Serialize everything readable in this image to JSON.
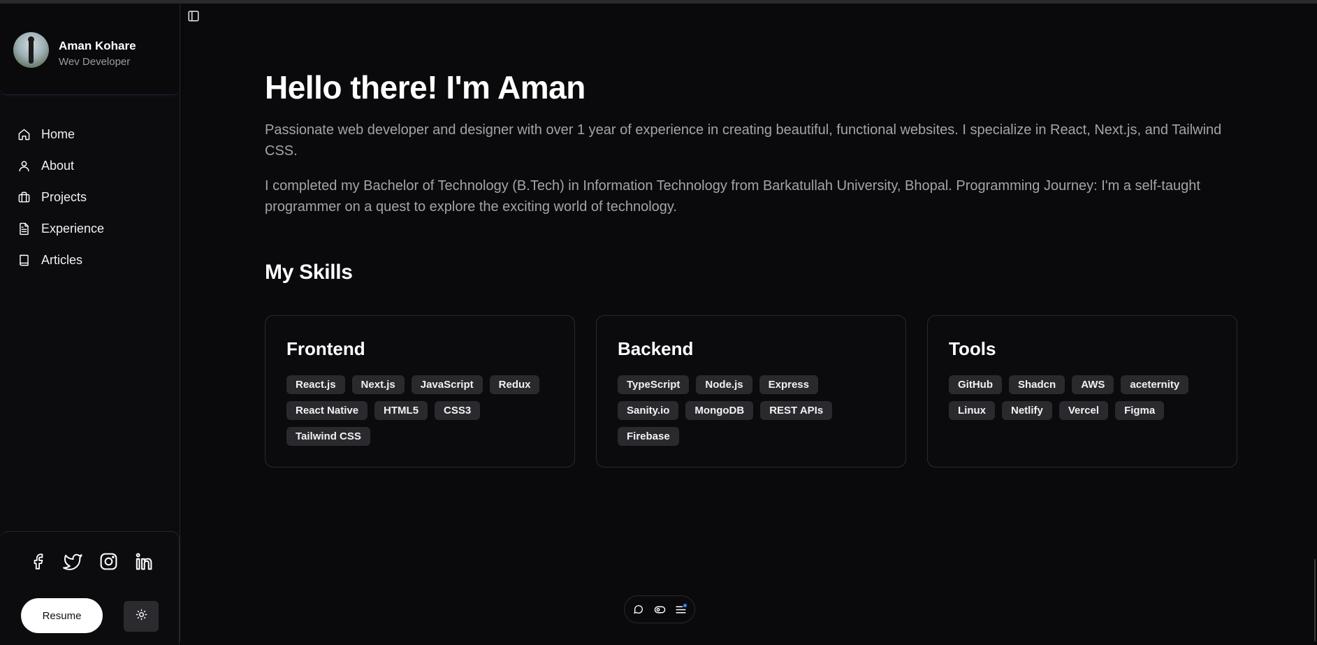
{
  "profile": {
    "name": "Aman Kohare",
    "role": "Wev Developer"
  },
  "nav": {
    "items": [
      {
        "label": "Home",
        "icon": "home-icon"
      },
      {
        "label": "About",
        "icon": "user-icon"
      },
      {
        "label": "Projects",
        "icon": "briefcase-icon"
      },
      {
        "label": "Experience",
        "icon": "document-icon"
      },
      {
        "label": "Articles",
        "icon": "book-icon"
      }
    ]
  },
  "social": {
    "icons": [
      "facebook-icon",
      "twitter-icon",
      "instagram-icon",
      "linkedin-icon"
    ],
    "resume_label": "Resume"
  },
  "hero": {
    "title": "Hello there! I'm Aman",
    "intro_1": "Passionate web developer and designer with over 1 year of experience in creating beautiful, functional websites. I specialize in React, Next.js, and Tailwind CSS.",
    "intro_2": "I completed my Bachelor of Technology (B.Tech) in Information Technology from Barkatullah University, Bhopal. Programming Journey: I'm a self-taught programmer on a quest to explore the exciting world of technology."
  },
  "skills": {
    "title": "My Skills",
    "cards": [
      {
        "title": "Frontend",
        "tags": [
          "React.js",
          "Next.js",
          "JavaScript",
          "Redux",
          "React Native",
          "HTML5",
          "CSS3",
          "Tailwind CSS"
        ]
      },
      {
        "title": "Backend",
        "tags": [
          "TypeScript",
          "Node.js",
          "Express",
          "Sanity.io",
          "MongoDB",
          "REST APIs",
          "Firebase"
        ]
      },
      {
        "title": "Tools",
        "tags": [
          "GitHub",
          "Shadcn",
          "AWS",
          "aceternity",
          "Linux",
          "Netlify",
          "Vercel",
          "Figma"
        ]
      }
    ]
  },
  "colors": {
    "background": "#0a0a0c",
    "tag_bg": "#2a2a2e",
    "accent_dot": "#3b82f6"
  }
}
